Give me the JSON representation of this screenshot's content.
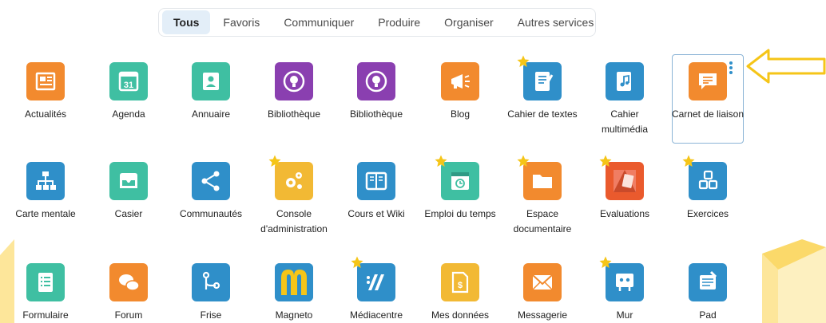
{
  "tabs": [
    "Tous",
    "Favoris",
    "Communiquer",
    "Produire",
    "Organiser",
    "Autres services"
  ],
  "active_tab": "Tous",
  "apps": [
    {
      "label": "Actualités",
      "icon": "newspaper-icon",
      "color": "#f28a2e",
      "fav": false
    },
    {
      "label": "Agenda",
      "icon": "calendar-icon",
      "color": "#3fbfa2",
      "fav": false
    },
    {
      "label": "Annuaire",
      "icon": "address-book-icon",
      "color": "#3fbfa2",
      "fav": false
    },
    {
      "label": "Bibliothèque",
      "icon": "lightbulb-icon",
      "color": "#8a3fb0",
      "fav": false
    },
    {
      "label": "Bibliothèque",
      "icon": "lightbulb-icon",
      "color": "#8a3fb0",
      "fav": false
    },
    {
      "label": "Blog",
      "icon": "megaphone-icon",
      "color": "#f28a2e",
      "fav": false
    },
    {
      "label": "Cahier de textes",
      "icon": "notebook-icon",
      "color": "#2f8fc9",
      "fav": true
    },
    {
      "label": "Cahier multimédia",
      "icon": "music-notebook-icon",
      "color": "#2f8fc9",
      "fav": false
    },
    {
      "label": "Carnet de liaison",
      "icon": "message-icon",
      "color": "#f28a2e",
      "fav": false
    },
    {
      "label": "Carte mentale",
      "icon": "sitemap-icon",
      "color": "#2f8fc9",
      "fav": false
    },
    {
      "label": "Casier",
      "icon": "inbox-icon",
      "color": "#3fbfa2",
      "fav": false
    },
    {
      "label": "Communautés",
      "icon": "share-icon",
      "color": "#2f8fc9",
      "fav": false
    },
    {
      "label": "Console d'administration",
      "icon": "gears-icon",
      "color": "#f2b934",
      "fav": true
    },
    {
      "label": "Cours et Wiki",
      "icon": "book-icon",
      "color": "#2f8fc9",
      "fav": false
    },
    {
      "label": "Emploi du temps",
      "icon": "calendar-clock-icon",
      "color": "#3fbfa2",
      "fav": true
    },
    {
      "label": "Espace documentaire",
      "icon": "folder-icon",
      "color": "#f28a2e",
      "fav": true
    },
    {
      "label": "Evaluations",
      "icon": "evaluation-icon",
      "color": "#ea5a2d",
      "fav": true
    },
    {
      "label": "Exercices",
      "icon": "cubes-icon",
      "color": "#2f8fc9",
      "fav": true
    },
    {
      "label": "Formulaire",
      "icon": "form-icon",
      "color": "#3fbfa2",
      "fav": false
    },
    {
      "label": "Forum",
      "icon": "chat-bubbles-icon",
      "color": "#f28a2e",
      "fav": false
    },
    {
      "label": "Frise",
      "icon": "timeline-icon",
      "color": "#2f8fc9",
      "fav": false
    },
    {
      "label": "Magneto",
      "icon": "magneto-logo-icon",
      "color": "#2f8fc9",
      "fav": false
    },
    {
      "label": "Médiacentre",
      "icon": "mediacentre-icon",
      "color": "#2f8fc9",
      "fav": true
    },
    {
      "label": "Mes données",
      "icon": "data-file-icon",
      "color": "#f2b934",
      "fav": false
    },
    {
      "label": "Messagerie",
      "icon": "envelope-icon",
      "color": "#f28a2e",
      "fav": false
    },
    {
      "label": "Mur",
      "icon": "wall-icon",
      "color": "#2f8fc9",
      "fav": true
    },
    {
      "label": "Pad",
      "icon": "pad-icon",
      "color": "#2f8fc9",
      "fav": false
    }
  ],
  "selected_app": "Carnet de liaison"
}
